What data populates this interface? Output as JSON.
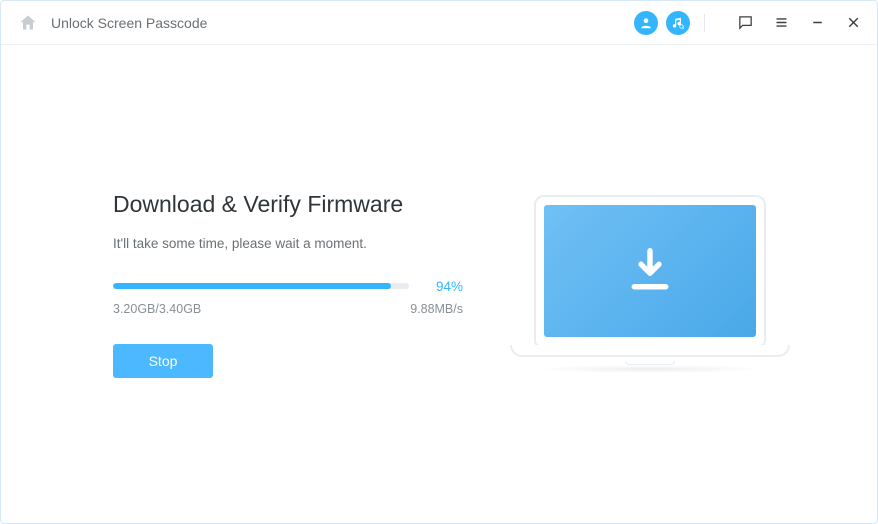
{
  "header": {
    "title": "Unlock Screen Passcode"
  },
  "main": {
    "heading": "Download & Verify Firmware",
    "subtitle": "It'll take some time, please wait a moment.",
    "progress": {
      "percent_label": "94%",
      "percent_value": 94,
      "downloaded": "3.20GB/3.40GB",
      "speed": "9.88MB/s"
    },
    "stop_label": "Stop"
  },
  "colors": {
    "accent": "#34b5ff"
  }
}
